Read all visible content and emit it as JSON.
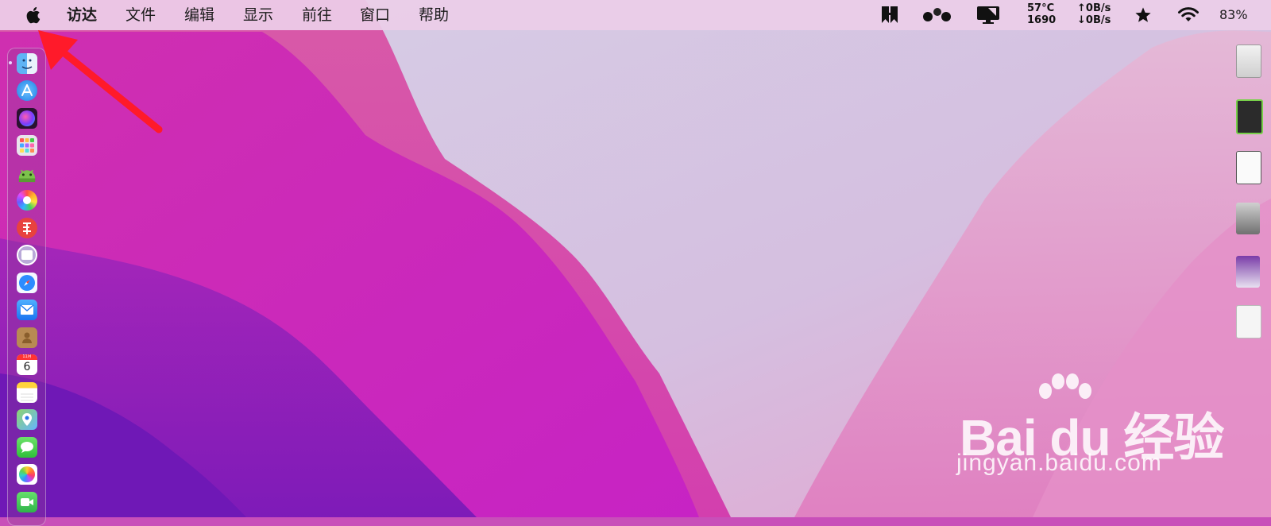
{
  "menubar": {
    "apple_menu": "apple-icon",
    "app_name": "访达",
    "items": [
      "文件",
      "编辑",
      "显示",
      "前往",
      "窗口",
      "帮助"
    ],
    "status": {
      "temperature": "57°C",
      "fan_speed": "1690",
      "net_up": "↑0B/s",
      "net_down": "↓0B/s",
      "battery_percent": "83%",
      "icons": [
        "bookmark-icon",
        "dots-icon",
        "display-icon",
        "star-icon",
        "wifi-icon"
      ]
    }
  },
  "dock": {
    "icons": [
      "finder-icon",
      "app-store-icon",
      "siri-icon",
      "launchpad-icon",
      "android-icon",
      "color-wheel-icon",
      "red-app-icon",
      "calculator-icon",
      "safari-icon",
      "mail-icon",
      "contacts-icon",
      "calendar-icon",
      "notes-icon",
      "maps-icon",
      "messages-icon",
      "photos-icon",
      "facetime-icon"
    ],
    "calendar_month": "11月",
    "calendar_day": "6"
  },
  "desktop_icons": [
    "document-icon",
    "app-icon",
    "document-icon",
    "image-icon",
    "image-icon",
    "document-icon"
  ],
  "watermark": {
    "logo_text": "Bai du 经验",
    "url": "jingyan.baidu.com"
  },
  "colors": {
    "menubar": "#ecd0e8",
    "wallpaper_magenta": "#c42fb6",
    "wallpaper_lavender": "#cfc3e4",
    "arrow": "#ff1a2a"
  }
}
